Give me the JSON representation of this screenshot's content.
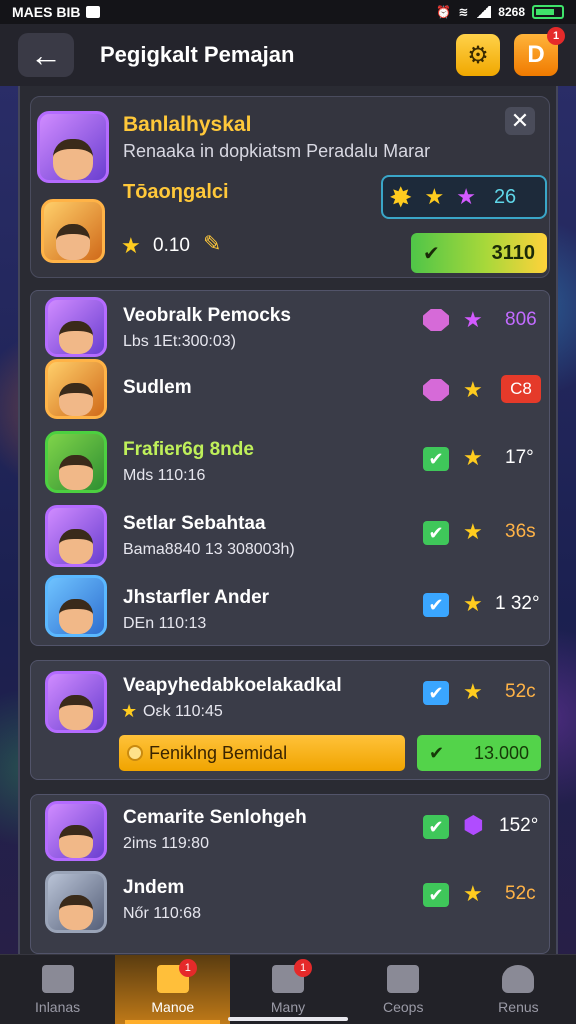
{
  "status": {
    "carrier": "MAES BIB",
    "time": "8268"
  },
  "header": {
    "title": "Pegigkalt Pemajan",
    "notif_count": "1"
  },
  "featured": {
    "title": "Banlalhyskal",
    "subtitle": "Renaaka in dopkiatsm Peradalu Marar",
    "name": "Tōaoηgalci",
    "score": "0.10",
    "rating": "26",
    "bar_value": "3110"
  },
  "group1": [
    {
      "name": "Veobralk Pemocks",
      "meta": "Lbs  1Et:300:03)",
      "value": "806",
      "value_color": "#c26bff"
    },
    {
      "name": "Sudlem",
      "meta": "",
      "value": "C8",
      "value_color": "#fff"
    },
    {
      "name": "Frafier6g 8nde",
      "meta": "Mds  110:16",
      "value": "17°",
      "value_color": "#fff"
    },
    {
      "name": "Setlar Sebahtaa",
      "meta": "Bama8840 13 308003h)",
      "value": "36s",
      "value_color": "#ffb347"
    },
    {
      "name": "Jhstarfler Ander",
      "meta": "DEn  110:13",
      "value": "1 32°",
      "value_color": "#fff"
    }
  ],
  "group2": {
    "name": "Veapyhedabkoelakadkal",
    "meta": "Oεk  110:45",
    "value": "52c",
    "button_label": "Feniklng Bemidal",
    "button_value": "13.000"
  },
  "group3": [
    {
      "name": "Cemarite Senlohgeh",
      "meta": "2ims  119:80",
      "value": "152°"
    },
    {
      "name": "Jndem",
      "meta": "Nőr  110:68",
      "value": "52c"
    }
  ],
  "nav": [
    {
      "label": "Inlanas",
      "badge": ""
    },
    {
      "label": "Manoe",
      "badge": "1"
    },
    {
      "label": "Many",
      "badge": "1"
    },
    {
      "label": "Ceops",
      "badge": ""
    },
    {
      "label": "Renus",
      "badge": ""
    }
  ]
}
